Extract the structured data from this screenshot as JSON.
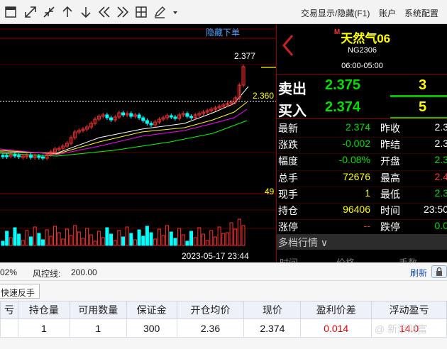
{
  "toolbar": {
    "icons": [
      "fullscreen-icon",
      "expand-icon",
      "collapse-icon",
      "arrow-up-icon",
      "arrow-down-icon",
      "double-left-icon",
      "double-right-icon",
      "layout-grid-icon",
      "pen-icon",
      "dropdown-icon"
    ],
    "menu": [
      {
        "label": "交易显示/隐藏(F1)"
      },
      {
        "label": "账户"
      },
      {
        "label": "系统配置"
      }
    ]
  },
  "chart": {
    "hide_orders_link": "隐藏下单",
    "high_label": "2.377",
    "price_line_label": "2.360",
    "vol_axis_label": "49",
    "cursor_time": "2023-05-17 23:44",
    "colors": {
      "up": "#ff3030",
      "down": "#00ffff",
      "ma5": "#ffffff",
      "ma10": "#ffff00",
      "ma20": "#ff00ff",
      "ma60": "#00ff00"
    }
  },
  "quote": {
    "name_prefix": "M",
    "name": "天然气06",
    "code": "NG2306",
    "hours": "06:00-05:00",
    "ask": {
      "label": "卖出",
      "price": "2.375",
      "qty": "3"
    },
    "bid": {
      "label": "买入",
      "price": "2.374",
      "qty": "5"
    },
    "rows": [
      {
        "l1": "最新",
        "v1": "2.374",
        "c1": "#00e000",
        "l2": "昨收",
        "v2": "2.3"
      },
      {
        "l1": "涨跌",
        "v1": "-0.002",
        "c1": "#00e000",
        "l2": "昨结",
        "v2": "2.3"
      },
      {
        "l1": "幅度",
        "v1": "-0.08%",
        "c1": "#00e000",
        "l2": "开盘",
        "v2": "2.3",
        "c2": "#00e000"
      },
      {
        "l1": "总手",
        "v1": "72676",
        "c1": "#ffff00",
        "l2": "最高",
        "v2": "2.4",
        "c2": "#ff3030"
      },
      {
        "l1": "现手",
        "v1": "1",
        "c1": "#ffff00",
        "l2": "最低",
        "v2": "2.3",
        "c2": "#00e000"
      },
      {
        "l1": "持仓",
        "v1": "96406",
        "c1": "#ffff00",
        "l2": "时间",
        "v2": "23:50"
      },
      {
        "l1": "涨停",
        "v1": "--",
        "c1": "#ff3030",
        "l2": "跌停",
        "v2": "0.0",
        "c2": "#00e000"
      }
    ],
    "depth_title": "多档行情",
    "depth_cols": [
      "时间",
      "价格",
      "手数"
    ]
  },
  "bottom": {
    "risk_prefix": "02%",
    "risk_label": "风控线:",
    "risk_value": "200.00",
    "refresh": "刷新",
    "reverse_button": "快速反手",
    "table": {
      "headers": [
        "亏",
        "持仓量",
        "可用数量",
        "保证金",
        "开仓均价",
        "现价",
        "盈利价差",
        "浮动盈亏"
      ],
      "row": [
        "",
        "1",
        "1",
        "300",
        "2.36",
        "2.374",
        "0.014",
        "14.0"
      ]
    },
    "watermark": "@ 新浪财富"
  }
}
